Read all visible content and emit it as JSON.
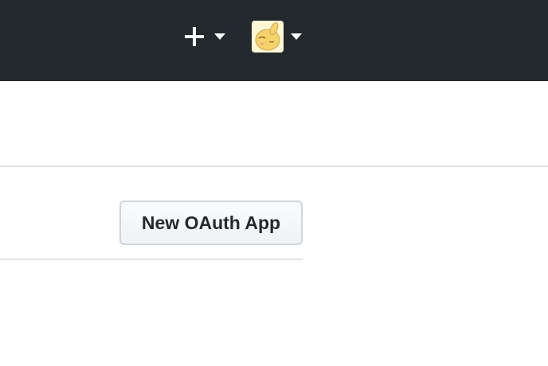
{
  "header": {
    "background": "#24292e",
    "create_menu": {
      "icon": "plus-icon",
      "dropdown_icon": "caret-down-icon"
    },
    "user_menu": {
      "avatar_icon": "user-avatar",
      "dropdown_icon": "caret-down-icon"
    }
  },
  "main": {
    "new_app_button_label": "New OAuth App"
  },
  "colors": {
    "header_bg": "#24292e",
    "button_text": "#24292e",
    "button_border": "#d1d5da",
    "divider": "#e1e4e8",
    "avatar_fill": "#f6d36a"
  }
}
